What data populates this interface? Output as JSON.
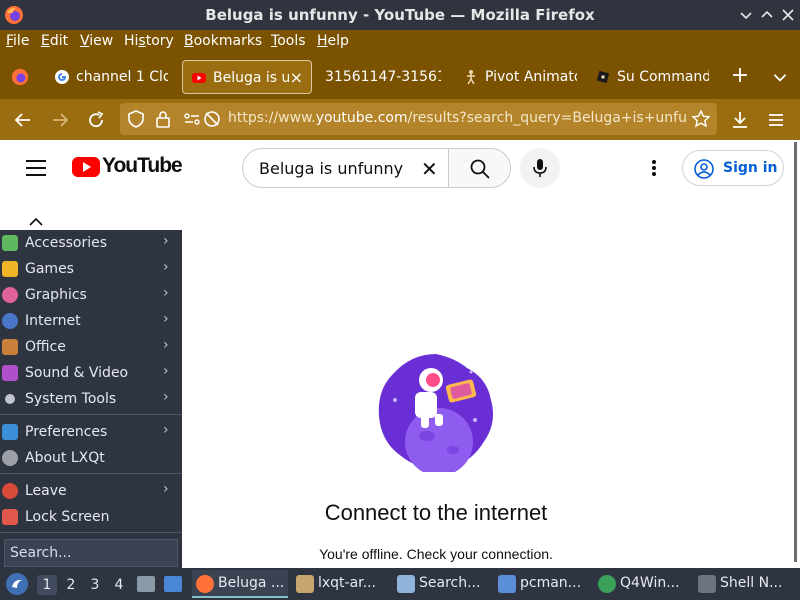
{
  "window": {
    "title": "Beluga is unfunny - YouTube — Mozilla Firefox",
    "minimize_icon": "chevron-down-icon",
    "maximize_icon": "chevron-up-icon",
    "close_icon": "close-icon"
  },
  "menubar": {
    "items": [
      {
        "label": "File",
        "accel": "F"
      },
      {
        "label": "Edit",
        "accel": "E"
      },
      {
        "label": "View",
        "accel": "V"
      },
      {
        "label": "History",
        "accel": "s"
      },
      {
        "label": "Bookmarks",
        "accel": "B"
      },
      {
        "label": "Tools",
        "accel": "T"
      },
      {
        "label": "Help",
        "accel": "H"
      }
    ]
  },
  "tabs": [
    {
      "label": "channel 1 Clo",
      "icon": "google-icon"
    },
    {
      "label": "Beluga is unfu",
      "icon": "youtube-icon",
      "active": true,
      "close": "×"
    },
    {
      "label": "31561147-31561",
      "icon": "none"
    },
    {
      "label": "Pivot Animato",
      "icon": "stickfigure-icon"
    },
    {
      "label": "Su Command",
      "icon": "roblox-icon"
    }
  ],
  "tabbar": {
    "new_tab": "+",
    "list_all": "⌄"
  },
  "navbar": {
    "url_prefix": "https://www.",
    "url_domain": "youtube.com",
    "url_suffix": "/results?search_query=Beluga+is+unfunny"
  },
  "youtube": {
    "logo_text": "YouTube",
    "search_value": "Beluga is unfunny",
    "clear_glyph": "✕",
    "signin_label": "Sign in",
    "offline_heading": "Connect to the internet",
    "offline_sub": "You're offline. Check your connection."
  },
  "startmenu": {
    "items": [
      {
        "label": "Accessories",
        "color": "#5fb760",
        "submenu": true
      },
      {
        "label": "Games",
        "color": "#f0b429",
        "submenu": true
      },
      {
        "label": "Graphics",
        "color": "#e0629a",
        "submenu": true
      },
      {
        "label": "Internet",
        "color": "#4a78c8",
        "submenu": true
      },
      {
        "label": "Office",
        "color": "#c9803a",
        "submenu": true
      },
      {
        "label": "Sound & Video",
        "color": "#b050c8",
        "submenu": true
      },
      {
        "label": "System Tools",
        "color": "#c0c5ce",
        "submenu": true
      },
      {
        "label": "Preferences",
        "color": "#3b8fd9",
        "submenu": true
      },
      {
        "label": "About LXQt",
        "color": "#9aa0a6",
        "submenu": false
      },
      {
        "label": "Leave",
        "color": "#d84a3a",
        "submenu": true
      },
      {
        "label": "Lock Screen",
        "color": "#e2574c",
        "submenu": false
      }
    ],
    "search_placeholder": "Search..."
  },
  "taskbar": {
    "workspaces": [
      "1",
      "2",
      "3",
      "4"
    ],
    "tasks": [
      {
        "label": "Beluga ...",
        "color": "#ff7139",
        "active": true
      },
      {
        "label": "lxqt-ar...",
        "color": "#c8a46e"
      },
      {
        "label": "Search...",
        "color": "#8fb3d9"
      },
      {
        "label": "pcman...",
        "color": "#5a8fd6"
      },
      {
        "label": "Q4Win...",
        "color": "#3aa05a"
      },
      {
        "label": "Shell N...",
        "color": "#6b7280"
      }
    ]
  }
}
